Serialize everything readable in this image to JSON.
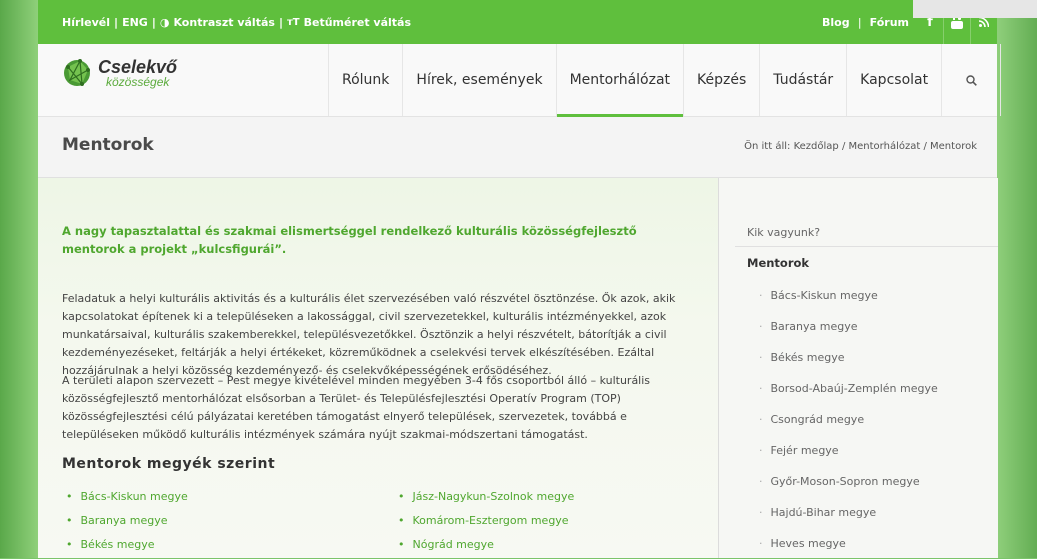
{
  "topbar": {
    "newsletter": "Hírlevél",
    "lang": "ENG",
    "contrast": "Kontraszt váltás",
    "fontsize": "Betűméret váltás",
    "blog": "Blog",
    "forum": "Fórum",
    "icons": [
      "facebook-icon",
      "youtube-icon",
      "rss-icon"
    ]
  },
  "logo": {
    "line1": "Cselekvő",
    "line2": "közösségek"
  },
  "nav": [
    {
      "label": "Rólunk"
    },
    {
      "label": "Hírek, események"
    },
    {
      "label": "Mentorhálózat",
      "active": true
    },
    {
      "label": "Képzés"
    },
    {
      "label": "Tudástár"
    },
    {
      "label": "Kapcsolat"
    }
  ],
  "page": {
    "title": "Mentorok",
    "breadcrumb": {
      "prefix": "Ön itt áll:",
      "items": [
        "Kezdőlap",
        "Mentorhálózat",
        "Mentorok"
      ]
    },
    "lead": "A nagy tapasztalattal és szakmai elismertséggel rendelkező kulturális közösségfejlesztő mentorok a projekt „kulcsfigurái”.",
    "para1": "Feladatuk a helyi kulturális aktivitás és a kulturális élet szervezésében való részvétel ösztönzése. Ők azok, akik kapcsolatokat építenek ki a településeken a lakossággal, civil szervezetekkel, kulturális intézményekkel, azok munkatársaival, kulturális szakemberekkel, településvezetőkkel. Ösztönzik a helyi részvételt, bátorítják a civil kezdeményezéseket, feltárják a helyi értékeket, közreműködnek a cselekvési tervek elkészítésében. Ezáltal hozzájárulnak a helyi közösség kezdeményező- és cselekvőképességének erősödéséhez.",
    "para2": "A területi alapon szervezett – Pest megye kivételével minden megyében 3-4 fős csoportból álló – kulturális közösségfejlesztő mentorhálózat elsősorban a Terület- és Településfejlesztési Operatív Program (TOP) közösségfejlesztési célú pályázatai keretében támogatást elnyerő települések, szervezetek, továbbá e településeken működő kulturális intézmények számára nyújt szakmai-módszertani támogatást.",
    "subhead": "Mentorok megyék szerint",
    "col1": [
      "Bács-Kiskun megye",
      "Baranya megye",
      "Békés megye"
    ],
    "col2": [
      "Jász-Nagykun-Szolnok megye",
      "Komárom-Esztergom megye",
      "Nógrád megye"
    ]
  },
  "sidebar": {
    "title": "Kik vagyunk?",
    "current": "Mentorok",
    "items": [
      "Bács-Kiskun megye",
      "Baranya megye",
      "Békés megye",
      "Borsod-Abaúj-Zemplén megye",
      "Csongrád megye",
      "Fejér megye",
      "Győr-Moson-Sopron megye",
      "Hajdú-Bihar megye",
      "Heves megye"
    ]
  },
  "colors": {
    "accent": "#5fbf3d",
    "link": "#4fa72f"
  }
}
